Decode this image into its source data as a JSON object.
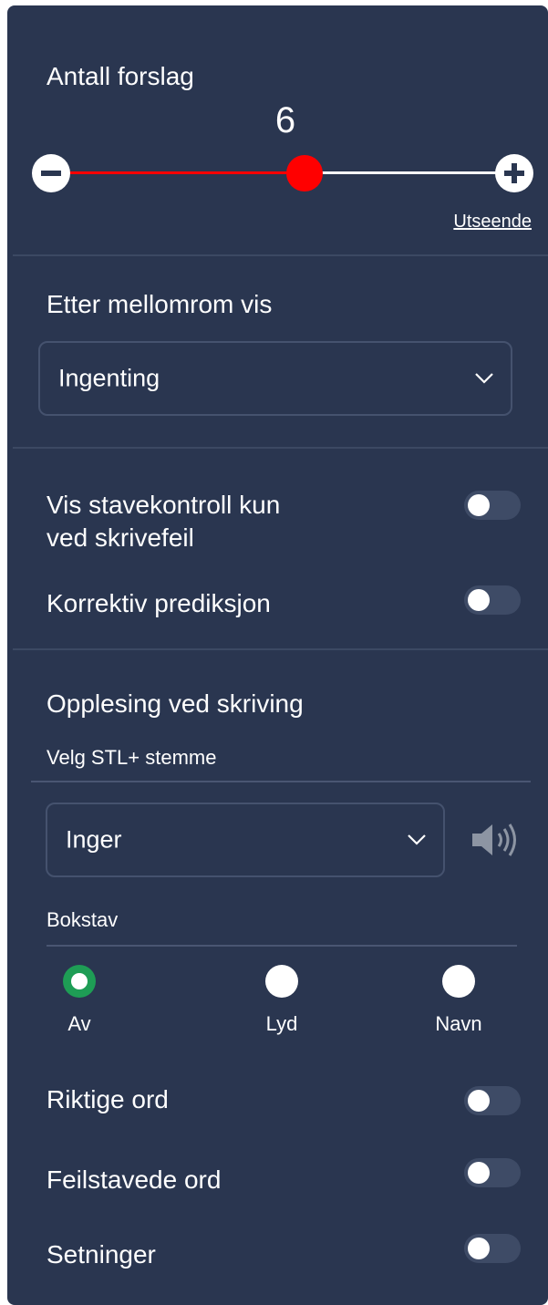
{
  "suggestions": {
    "title": "Antall forslag",
    "value": "6",
    "slider_fraction": 0.55,
    "track_fill_color": "#ff0000",
    "appearance_link": "Utseende"
  },
  "after_space": {
    "title": "Etter mellomrom vis",
    "select_value": "Ingenting"
  },
  "toggles_spell": {
    "spellcheck_label_line1": "Vis stavekontroll kun",
    "spellcheck_label_line2": "ved skrivefeil",
    "spellcheck_on": false,
    "corrective_label": "Korrektiv prediksjon",
    "corrective_on": false
  },
  "reading": {
    "title": "Opplesing ved skriving",
    "voice_label": "Velg STL+ stemme",
    "voice_value": "Inger",
    "speaker_icon": "speaker-icon",
    "letter_title": "Bokstav",
    "letter_options": [
      {
        "label": "Av",
        "selected": true
      },
      {
        "label": "Lyd",
        "selected": false
      },
      {
        "label": "Navn",
        "selected": false
      }
    ],
    "correct_words_label": "Riktige ord",
    "correct_words_on": false,
    "misspelled_words_label": "Feilstavede ord",
    "misspelled_words_on": false,
    "sentences_label": "Setninger",
    "sentences_on": false
  },
  "colors": {
    "panel_bg": "#2a3650",
    "radio_selected": "#1e9d55"
  }
}
